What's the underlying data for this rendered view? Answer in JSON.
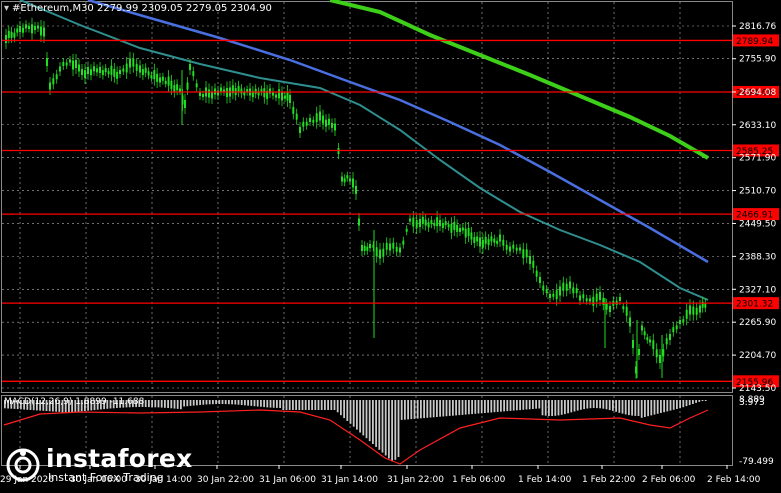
{
  "header": {
    "symbol_line": "#Ethereum,M30  2279.99 2309.05 2279.05 2304.90"
  },
  "indicator": {
    "label": "MACD(12,26,9) 1.8899 -11.688",
    "levels": [
      "8.889",
      "3.973",
      "-79.499"
    ]
  },
  "price_axis": {
    "ticks": [
      "2816.76",
      "2755.90",
      "2694.08",
      "2633.10",
      "2571.90",
      "2510.70",
      "2449.50",
      "2388.30",
      "2327.10",
      "2265.90",
      "2204.70",
      "2143.50"
    ]
  },
  "horizontal_levels": [
    {
      "label": "2789.94",
      "value": 2789.94
    },
    {
      "label": "2694.08",
      "value": 2694.08
    },
    {
      "label": "2585.25",
      "value": 2585.25
    },
    {
      "label": "2466.91",
      "value": 2466.91
    },
    {
      "label": "2301.32",
      "value": 2301.32
    },
    {
      "label": "2155.96",
      "value": 2155.96
    }
  ],
  "current_price": {
    "label": "2301.32"
  },
  "time_axis": {
    "labels": [
      "29 Jan 2026",
      "30 Jan 06:00",
      "30 Jan 14:00",
      "30 Jan 22:00",
      "31 Jan 06:00",
      "31 Jan 14:00",
      "31 Jan 22:00",
      "1 Feb 06:00",
      "1 Feb 14:00",
      "1 Feb 22:00",
      "2 Feb 06:00",
      "2 Feb 14:00"
    ]
  },
  "watermark": {
    "name": "instaforex",
    "tagline": "Instant Forex Trading"
  },
  "colors": {
    "level_line": "#ff0000",
    "ma_fast": "#2f8f8f",
    "ma_mid": "#4a6fe0",
    "ma_slow": "#3ecf1a",
    "candle": "#22dd22",
    "macd_hist": "#c8c8c8",
    "macd_signal": "#ff2020"
  }
}
